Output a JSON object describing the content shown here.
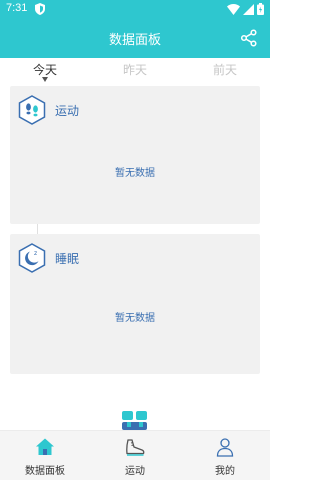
{
  "status_bar": {
    "time": "7:31"
  },
  "header": {
    "title": "数据面板",
    "share_icon": "share-icon"
  },
  "tabs": [
    {
      "label": "今天",
      "active": true
    },
    {
      "label": "昨天",
      "active": false
    },
    {
      "label": "前天",
      "active": false
    }
  ],
  "cards": {
    "sport": {
      "title": "运动",
      "empty_text": "暂无数据",
      "icon": "footprints-icon"
    },
    "sleep": {
      "title": "睡眠",
      "empty_text": "暂无数据",
      "icon": "moon-icon"
    }
  },
  "bottom_nav": [
    {
      "label": "数据面板",
      "icon": "home-icon",
      "active": true
    },
    {
      "label": "运动",
      "icon": "shoe-icon",
      "active": false
    },
    {
      "label": "我的",
      "icon": "user-icon",
      "active": false
    }
  ],
  "colors": {
    "primary": "#2ec7cf",
    "card_text": "#3a6fb1",
    "card_bg": "#f1f1f1"
  }
}
